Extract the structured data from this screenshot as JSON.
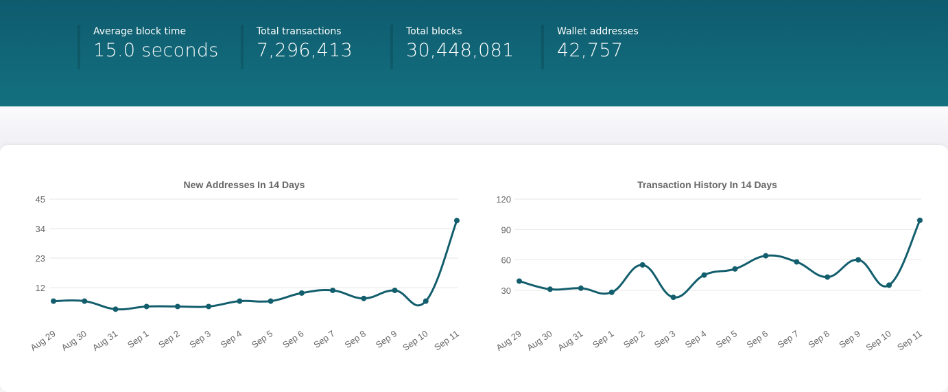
{
  "stats": [
    {
      "label": "Average block time",
      "value": "15.0 seconds"
    },
    {
      "label": "Total transactions",
      "value": "7,296,413"
    },
    {
      "label": "Total blocks",
      "value": "30,448,081"
    },
    {
      "label": "Wallet addresses",
      "value": "42,757"
    }
  ],
  "colors": {
    "header": "#0e5b6e",
    "line": "#135e6d",
    "grid": "#e6e6e6"
  },
  "chart_data": [
    {
      "type": "line",
      "title": "New Addresses In 14 Days",
      "categories": [
        "Aug 29",
        "Aug 30",
        "Aug 31",
        "Sep 1",
        "Sep 2",
        "Sep 3",
        "Sep 4",
        "Sep 5",
        "Sep 6",
        "Sep 7",
        "Sep 8",
        "Sep 9",
        "Sep 10",
        "Sep 11"
      ],
      "values": [
        7,
        7,
        4,
        5,
        5,
        5,
        7,
        7,
        10,
        11,
        8,
        11,
        7,
        37
      ],
      "yticks": [
        12,
        23,
        34,
        45
      ],
      "ylim": [
        0,
        45
      ],
      "grid": true,
      "smooth": true
    },
    {
      "type": "line",
      "title": "Transaction History In 14 Days",
      "categories": [
        "Aug 29",
        "Aug 30",
        "Aug 31",
        "Sep 1",
        "Sep 2",
        "Sep 3",
        "Sep 4",
        "Sep 5",
        "Sep 6",
        "Sep 7",
        "Sep 8",
        "Sep 9",
        "Sep 10",
        "Sep 11"
      ],
      "values": [
        39,
        31,
        32,
        28,
        55,
        23,
        45,
        51,
        64,
        58,
        43,
        60,
        35,
        99
      ],
      "yticks": [
        30,
        60,
        90,
        120
      ],
      "ylim": [
        0,
        120
      ],
      "grid": true,
      "smooth": true
    }
  ]
}
